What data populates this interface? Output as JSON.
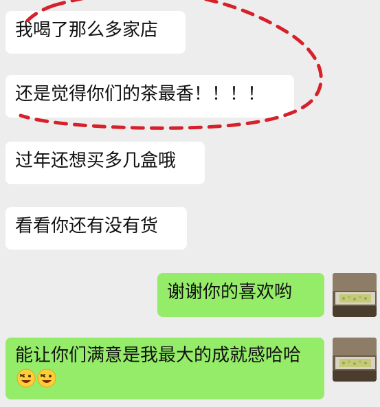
{
  "colors": {
    "background": "#ededed",
    "incoming_bubble": "#ffffff",
    "outgoing_bubble": "#95ec69",
    "annotation": "#d6202a"
  },
  "messages": [
    {
      "direction": "incoming",
      "text": "我喝了那么多家店"
    },
    {
      "direction": "incoming",
      "text": "还是觉得你们的茶最香！！！！"
    },
    {
      "direction": "incoming",
      "text": "过年还想买多几盒哦"
    },
    {
      "direction": "incoming",
      "text": "看看你还有没有货"
    },
    {
      "direction": "outgoing",
      "text": "谢谢你的喜欢哟"
    },
    {
      "direction": "outgoing",
      "text": "能让你们满意是我最大的成就感哈哈",
      "emoji": [
        "grinning-face-icon",
        "grinning-face-icon"
      ]
    }
  ],
  "annotation": {
    "shape": "red-dashed-oval-icon"
  },
  "avatar": {
    "icon": "tea-leaves-avatar-icon"
  }
}
